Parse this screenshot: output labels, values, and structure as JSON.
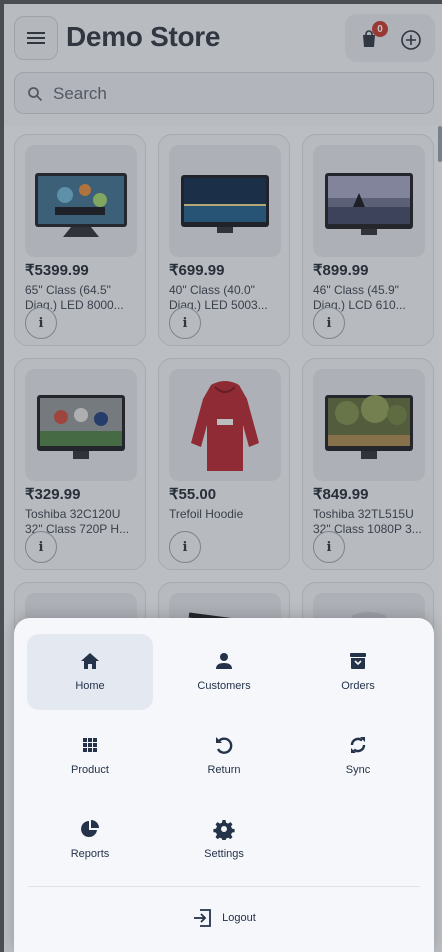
{
  "brand": {
    "part1": "Demo",
    "part2": "Store"
  },
  "cart": {
    "count": "0"
  },
  "search": {
    "placeholder": "Search"
  },
  "products": [
    {
      "price": "₹5399.99",
      "name": "65\" Class (64.5\" Diag.) LED 8000...",
      "image": "tv-smart"
    },
    {
      "price": "₹699.99",
      "name": "40\" Class (40.0\" Diag.) LED 5003...",
      "image": "tv-city"
    },
    {
      "price": "₹899.99",
      "name": "46\" Class (45.9\" Diag.) LCD 610...",
      "image": "tv-sunset"
    },
    {
      "price": "₹329.99",
      "name": "Toshiba 32C120U 32\" Class 720P H...",
      "image": "tv-sports"
    },
    {
      "price": "₹55.00",
      "name": "Trefoil Hoodie",
      "image": "hoodie"
    },
    {
      "price": "₹849.99",
      "name": "Toshiba 32TL515U 32\" Class 1080P 3...",
      "image": "tv-trees"
    }
  ],
  "menu": {
    "items": [
      {
        "label": "Home",
        "icon": "home-icon",
        "active": true
      },
      {
        "label": "Customers",
        "icon": "person-icon",
        "active": false
      },
      {
        "label": "Orders",
        "icon": "archive-icon",
        "active": false
      },
      {
        "label": "Product",
        "icon": "grid-icon",
        "active": false
      },
      {
        "label": "Return",
        "icon": "undo-icon",
        "active": false
      },
      {
        "label": "Sync",
        "icon": "sync-icon",
        "active": false
      },
      {
        "label": "Reports",
        "icon": "pie-chart-icon",
        "active": false
      },
      {
        "label": "Settings",
        "icon": "gear-icon",
        "active": false
      }
    ],
    "logout_label": "Logout"
  },
  "colors": {
    "accent": "#24324a",
    "badge": "#c0392b",
    "active_tile": "#e4e9f1"
  }
}
